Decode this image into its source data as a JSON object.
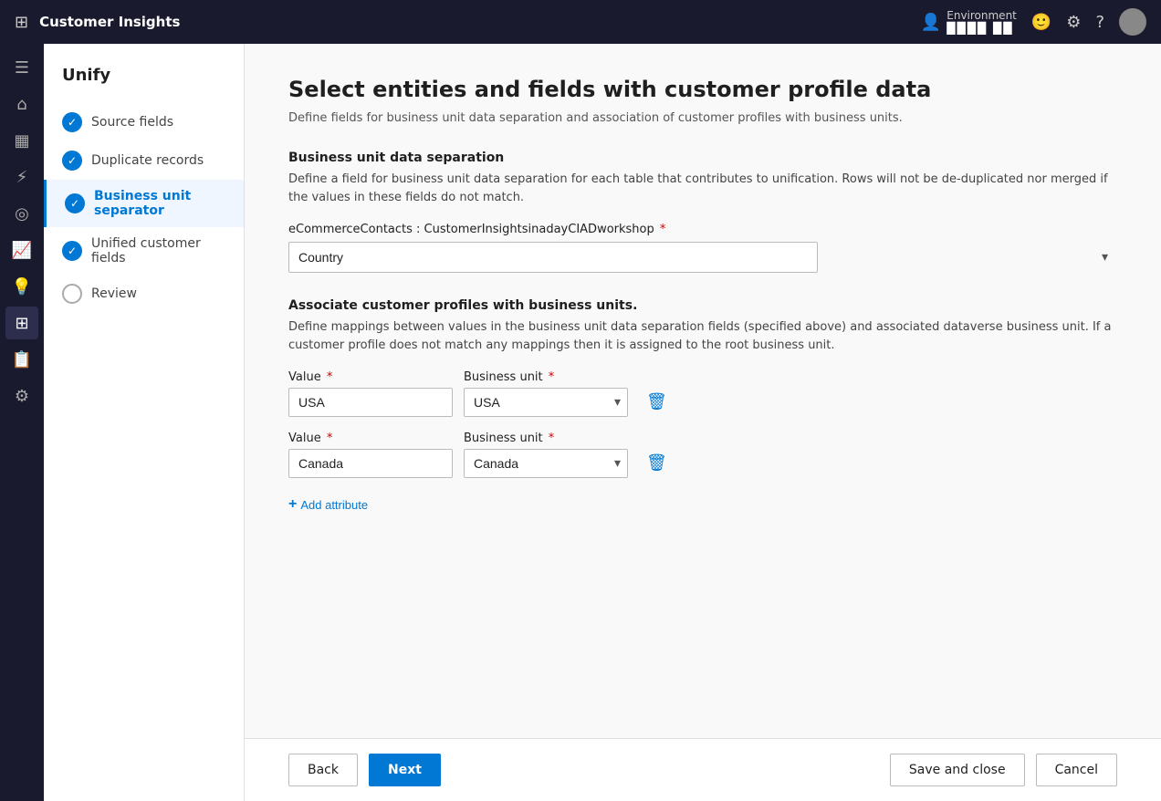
{
  "app": {
    "title": "Customer Insights",
    "env_label": "Environment",
    "env_value": "████ ██"
  },
  "topnav": {
    "icons": [
      "smiley",
      "settings",
      "help"
    ]
  },
  "sidebar": {
    "header": "Unify",
    "steps": [
      {
        "id": "source-fields",
        "label": "Source fields",
        "completed": true,
        "active": false
      },
      {
        "id": "duplicate-records",
        "label": "Duplicate records",
        "completed": true,
        "active": false
      },
      {
        "id": "business-unit-separator",
        "label": "Business unit separator",
        "completed": true,
        "active": true
      },
      {
        "id": "unified-customer-fields",
        "label": "Unified customer fields",
        "completed": true,
        "active": false
      },
      {
        "id": "review",
        "label": "Review",
        "completed": false,
        "active": false
      }
    ]
  },
  "page": {
    "title": "Select entities and fields with customer profile data",
    "subtitle": "Define fields for business unit data separation and association of customer profiles with business units.",
    "business_unit_section": {
      "title": "Business unit data separation",
      "desc": "Define a field for business unit data separation for each table that contributes to unification. Rows will not be de-duplicated nor merged if the values in these fields do not match.",
      "field_label": "eCommerceContacts : CustomerInsightsinadayCIADworkshop",
      "field_required": true,
      "dropdown_value": "Country",
      "dropdown_placeholder": "Country"
    },
    "associate_section": {
      "title": "Associate customer profiles with business units.",
      "desc": "Define mappings between values in the business unit data separation fields (specified above) and associated dataverse business unit. If a customer profile does not match any mappings then it is assigned to the root business unit.",
      "rows": [
        {
          "value_label": "Value",
          "value_required": true,
          "value": "USA",
          "unit_label": "Business unit",
          "unit_required": true,
          "unit": "USA"
        },
        {
          "value_label": "Value",
          "value_required": true,
          "value": "Canada",
          "unit_label": "Business unit",
          "unit_required": true,
          "unit": "Canada"
        }
      ],
      "add_label": "Add attribute"
    }
  },
  "footer": {
    "back_label": "Back",
    "next_label": "Next",
    "save_label": "Save and close",
    "cancel_label": "Cancel"
  },
  "rail_icons": [
    {
      "id": "home",
      "symbol": "⌂"
    },
    {
      "id": "dashboard",
      "symbol": "▦"
    },
    {
      "id": "analytics",
      "symbol": "⚡"
    },
    {
      "id": "target",
      "symbol": "◎"
    },
    {
      "id": "chart",
      "symbol": "📈"
    },
    {
      "id": "bulb",
      "symbol": "💡"
    },
    {
      "id": "data",
      "symbol": "⊞"
    },
    {
      "id": "report",
      "symbol": "📋"
    },
    {
      "id": "settings",
      "symbol": "⚙"
    }
  ]
}
